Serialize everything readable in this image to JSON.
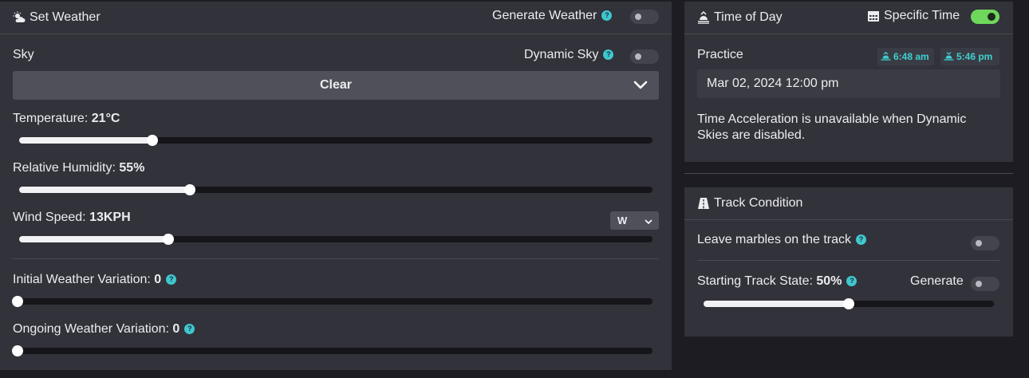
{
  "weather": {
    "title": "Set Weather",
    "generate_label": "Generate Weather",
    "generate_on": false,
    "sky_label": "Sky",
    "dynamic_sky_label": "Dynamic Sky",
    "dynamic_sky_on": false,
    "sky_value": "Clear",
    "temperature_label": "Temperature:",
    "temperature_value": "21°C",
    "temperature_level": 0.21,
    "humidity_label": "Relative Humidity:",
    "humidity_value": "55%",
    "humidity_level": 0.27,
    "wind_label": "Wind Speed:",
    "wind_value": "13KPH",
    "wind_level": 0.235,
    "wind_direction": "W",
    "initial_var_label": "Initial Weather Variation:",
    "initial_var_value": "0",
    "initial_var_level": 0,
    "ongoing_var_label": "Ongoing Weather Variation:",
    "ongoing_var_value": "0",
    "ongoing_var_level": 0
  },
  "time": {
    "title": "Time of Day",
    "specific_label": "Specific Time",
    "specific_on": true,
    "session_label": "Practice",
    "sunrise": "6:48 am",
    "sunset": "5:46 pm",
    "datetime": "Mar 02, 2024 12:00 pm",
    "note": "Time Acceleration is unavailable when Dynamic Skies are disabled."
  },
  "track": {
    "title": "Track Condition",
    "marbles_label": "Leave marbles on the track",
    "marbles_on": false,
    "state_label": "Starting Track State:",
    "state_value": "50%",
    "state_level": 0.5,
    "generate_label": "Generate",
    "generate_on": false
  },
  "colors": {
    "accent": "#3fc7cf",
    "toggle_on": "#6fd85c",
    "panel": "#32323a",
    "background": "#1c1c22"
  }
}
